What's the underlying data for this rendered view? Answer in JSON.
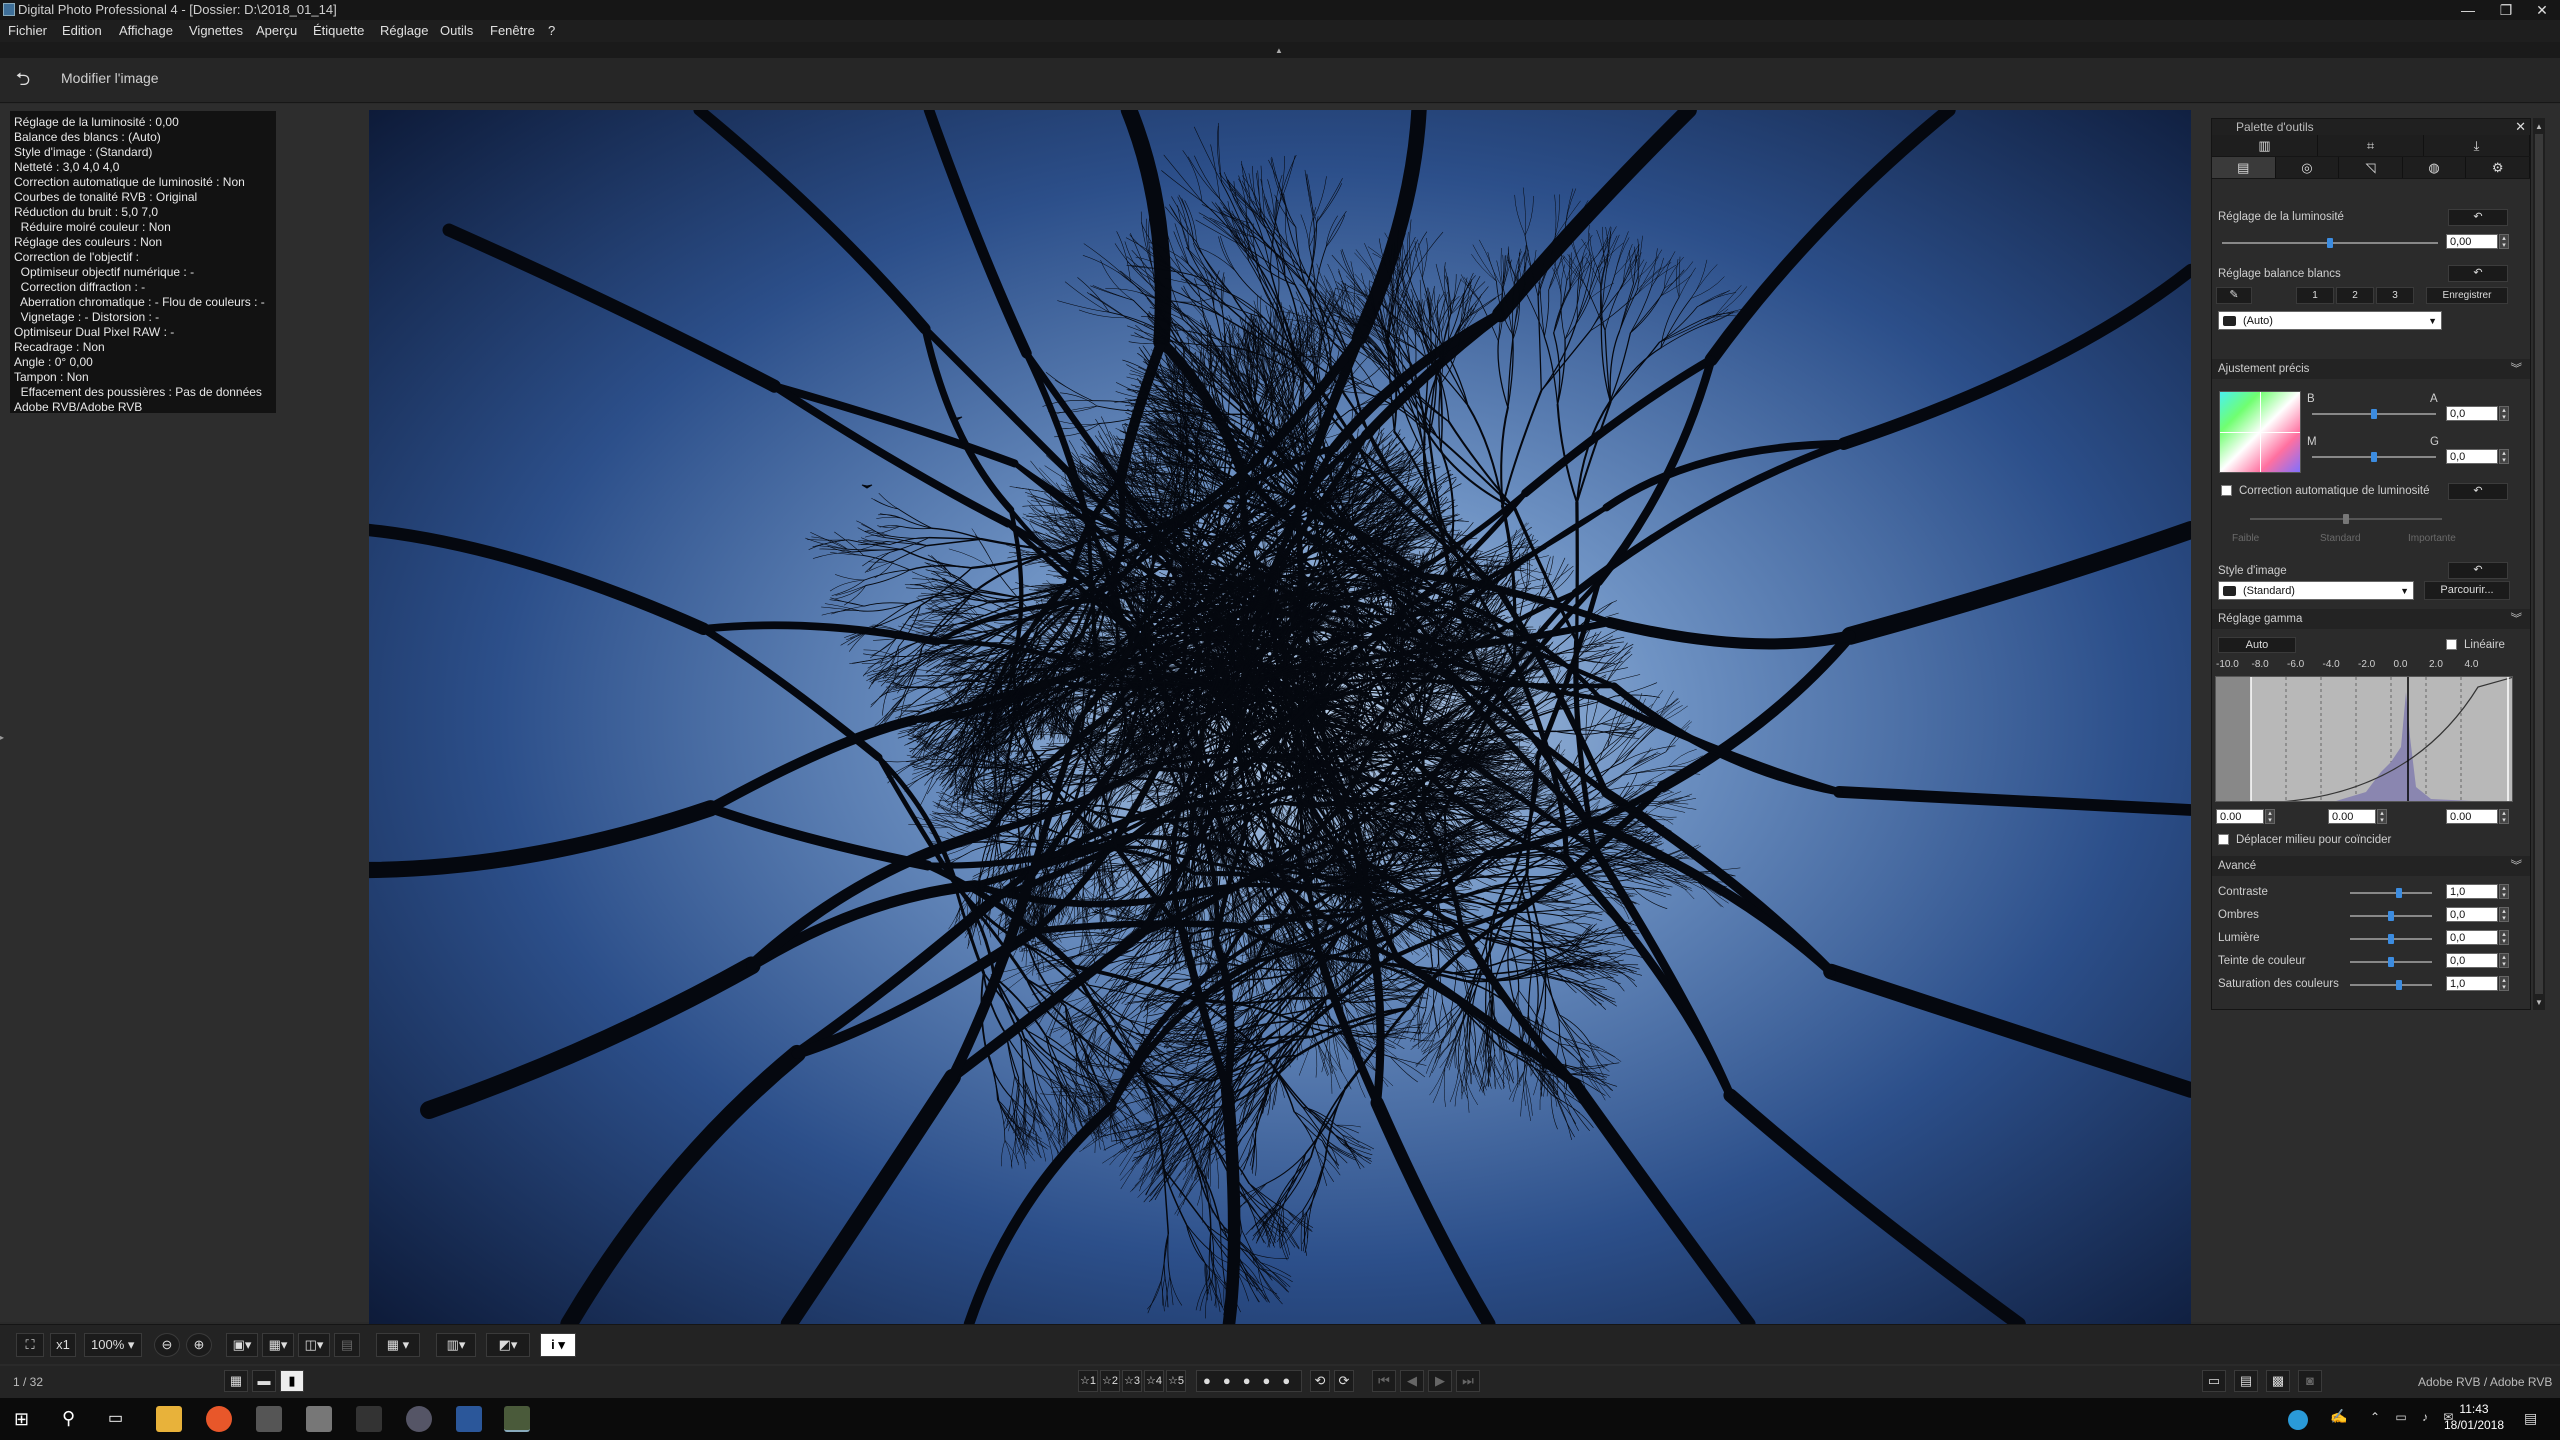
{
  "window": {
    "title": "Digital Photo Professional 4 - [Dossier: D:\\2018_01_14]"
  },
  "menu": [
    "Fichier",
    "Edition",
    "Affichage",
    "Vignettes",
    "Aperçu",
    "Étiquette",
    "Réglage",
    "Outils",
    "Fenêtre",
    "?"
  ],
  "toolbar": {
    "mode_label": "Modifier l'image"
  },
  "info_lines": [
    "Réglage de la luminosité : 0,00",
    "Balance des blancs : (Auto)",
    "Style d'image : (Standard)",
    "Netteté : 3,0 4,0 4,0",
    "Correction automatique de luminosité : Non",
    "Courbes de tonalité RVB : Original",
    "Réduction du bruit : 5,0 7,0",
    "  Réduire moiré couleur : Non",
    "Réglage des couleurs : Non",
    "Correction de l'objectif :",
    "  Optimiseur objectif numérique : -",
    "  Correction diffraction : -",
    "  Aberration chromatique : - Flou de couleurs : -",
    "  Vignetage : - Distorsion : -",
    "Optimiseur Dual Pixel RAW : -",
    "Recadrage : Non",
    "Angle : 0° 0,00",
    "Tampon : Non",
    "  Effacement des poussières : Pas de données",
    "Adobe RVB/Adobe RVB"
  ],
  "palette": {
    "title": "Palette d'outils",
    "brightness": {
      "label": "Réglage de la luminosité",
      "value": "0,00"
    },
    "wb": {
      "label": "Réglage balance blancs",
      "preset_buttons": [
        "1",
        "2",
        "3"
      ],
      "register_label": "Enregistrer",
      "selected": "(Auto)"
    },
    "fine": {
      "label": "Ajustement précis",
      "axis_b": "B",
      "axis_a": "A",
      "axis_m": "M",
      "axis_g": "G",
      "ba_value": "0,0",
      "mg_value": "0,0"
    },
    "auto_light": {
      "label": "Correction automatique de luminosité",
      "levels": [
        "Faible",
        "Standard",
        "Importante"
      ]
    },
    "picture_style": {
      "label": "Style d'image",
      "selected": "(Standard)",
      "browse_label": "Parcourir..."
    },
    "gamma": {
      "label": "Réglage gamma",
      "auto_label": "Auto",
      "linear_label": "Linéaire",
      "ticks": [
        "-10.0",
        "-8.0",
        "-6.0",
        "-4.0",
        "-2.0",
        "0.0",
        "2.0",
        "4.0"
      ],
      "left_value": "0.00",
      "mid_value": "0.00",
      "right_value": "0.00",
      "move_mid_label": "Déplacer milieu pour coïncider"
    },
    "advanced": {
      "label": "Avancé",
      "rows": [
        {
          "name": "Contraste",
          "value": "1,0",
          "level": 0.6
        },
        {
          "name": "Ombres",
          "value": "0,0",
          "level": 0.5
        },
        {
          "name": "Lumière",
          "value": "0,0",
          "level": 0.5
        },
        {
          "name": "Teinte de couleur",
          "value": "0,0",
          "level": 0.5
        },
        {
          "name": "Saturation des couleurs",
          "value": "1,0",
          "level": 0.6
        }
      ]
    },
    "levels": {
      "brightness": 0.5,
      "auto_light": 0.5,
      "ba": 0.5,
      "mg": 0.5
    }
  },
  "statusbar": {
    "zoom_x": "x1",
    "zoom": "100%",
    "info_icon": "i"
  },
  "bottombar": {
    "page": "1 / 32",
    "ratings": [
      "☆1",
      "☆2",
      "☆3",
      "☆4",
      "☆5"
    ],
    "colorspace": "Adobe RVB / Adobe RVB"
  },
  "taskbar": {
    "time": "11:43",
    "date": "18/01/2018"
  }
}
